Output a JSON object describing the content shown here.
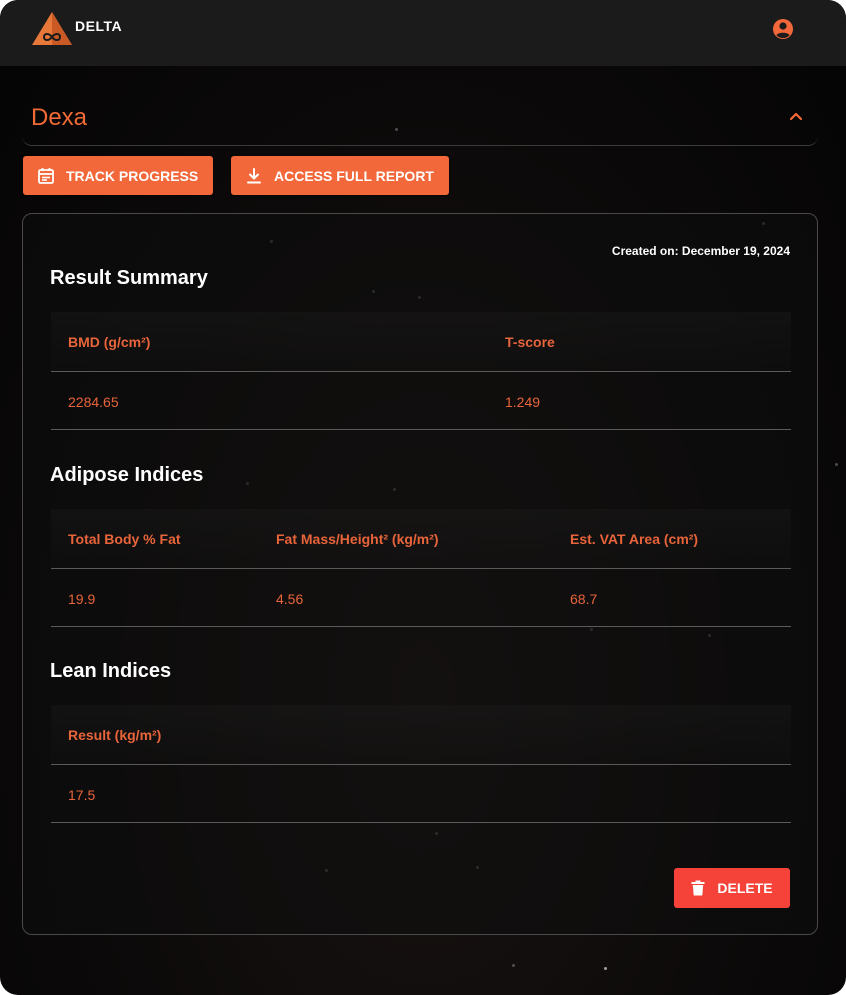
{
  "brand": {
    "name": "DELTA",
    "logo_icon": "triangle-infinity-logo",
    "accent": "#f2683a"
  },
  "header": {
    "profile_icon": "account-circle-icon"
  },
  "accordion": {
    "title": "Dexa",
    "toggle_icon": "chevron-up-icon"
  },
  "actions": {
    "track_progress": {
      "label": "TRACK PROGRESS",
      "icon": "calendar-icon"
    },
    "full_report": {
      "label": "ACCESS FULL REPORT",
      "icon": "download-icon"
    }
  },
  "card": {
    "created_on": "Created on: December 19, 2024",
    "sections": {
      "result_summary": {
        "title": "Result Summary",
        "headers": [
          "BMD (g/cm²)",
          "T-score"
        ],
        "values": [
          "2284.65",
          "1.249"
        ]
      },
      "adipose": {
        "title": "Adipose Indices",
        "headers": [
          "Total Body % Fat",
          "Fat Mass/Height² (kg/m²)",
          "Est. VAT Area (cm²)"
        ],
        "values": [
          "19.9",
          "4.56",
          "68.7"
        ]
      },
      "lean": {
        "title": "Lean Indices",
        "headers": [
          "Result (kg/m²)"
        ],
        "values": [
          "17.5"
        ]
      }
    },
    "delete": {
      "label": "DELETE",
      "icon": "trash-icon",
      "color": "#f5433a"
    }
  },
  "colors": {
    "table_text": "#e8643a",
    "background": "#0b0909",
    "topbar": "#1b1b1b"
  }
}
